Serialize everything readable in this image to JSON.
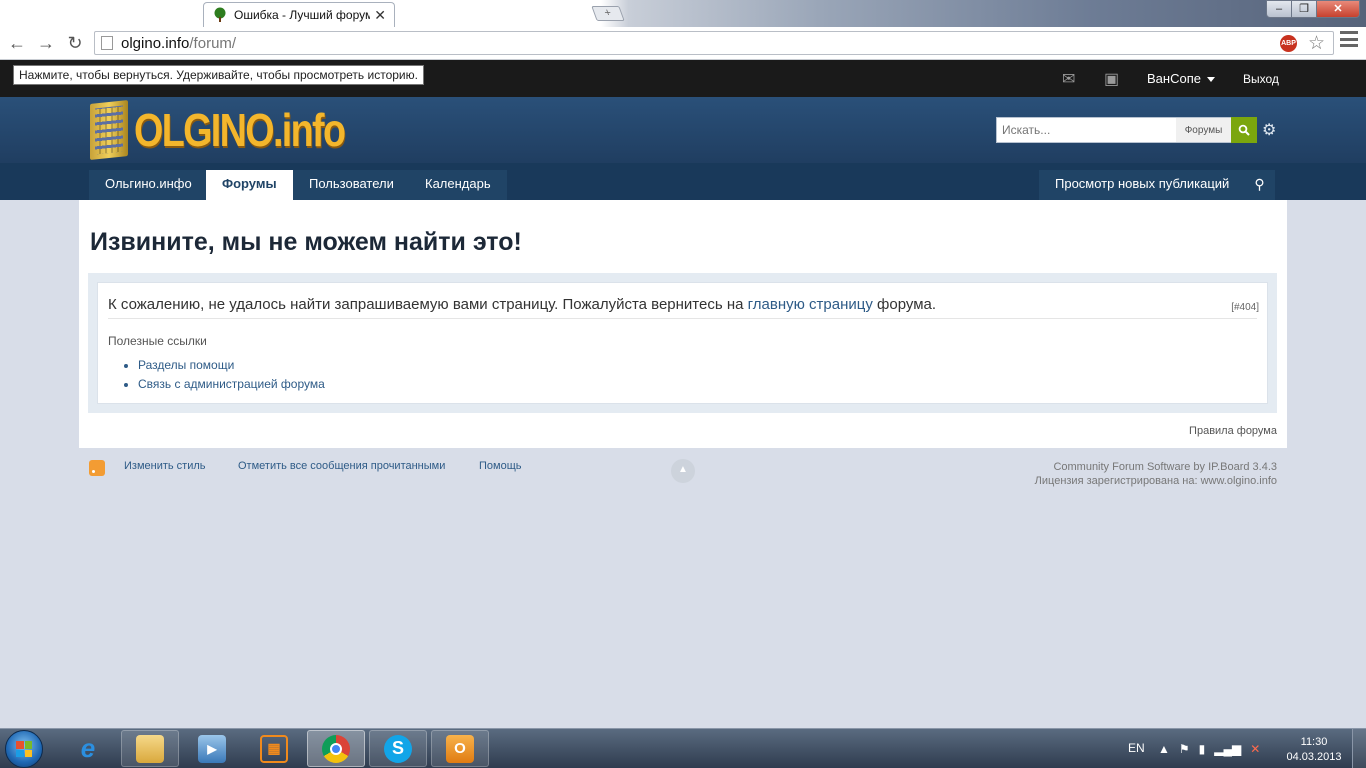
{
  "browser": {
    "tab_title": "Ошибка - Лучший форум",
    "url_host": "olgino.info",
    "url_path": "/forum/",
    "back_tooltip": "Нажмите, чтобы вернуться. Удерживайте, чтобы просмотреть историю.",
    "abp_label": "ABP"
  },
  "userbar": {
    "username": "ВанСопе",
    "logout": "Выход"
  },
  "branding": {
    "logo_text": "OLGINO.info",
    "search_placeholder": "Искать...",
    "search_scope": "Форумы"
  },
  "nav": {
    "tabs": [
      {
        "label": "Ольгино.инфо"
      },
      {
        "label": "Форумы"
      },
      {
        "label": "Пользователи"
      },
      {
        "label": "Календарь"
      }
    ],
    "active_tab": "Форумы",
    "new_content": "Просмотр новых публикаций"
  },
  "error": {
    "title": "Извините, мы не можем найти это!",
    "message_before": "К сожалению, не удалось найти запрашиваемую вами страницу. Пожалуйста вернитесь на ",
    "message_link": "главную страницу",
    "message_after": " форума.",
    "code": "[#404]",
    "useful_links_label": "Полезные ссылки",
    "links": [
      "Разделы помощи",
      "Связь с администрацией форума"
    ]
  },
  "forum_rules": "Правила форума",
  "footer": {
    "change_skin": "Изменить стиль",
    "mark_read": "Отметить все сообщения прочитанными",
    "help": "Помощь",
    "powered_by": "Community Forum Software by IP.Board 3.4.3",
    "license": "Лицензия зарегистрирована на: www.olgino.info"
  },
  "taskbar": {
    "language": "EN",
    "time": "11:30",
    "date": "04.03.2013"
  }
}
